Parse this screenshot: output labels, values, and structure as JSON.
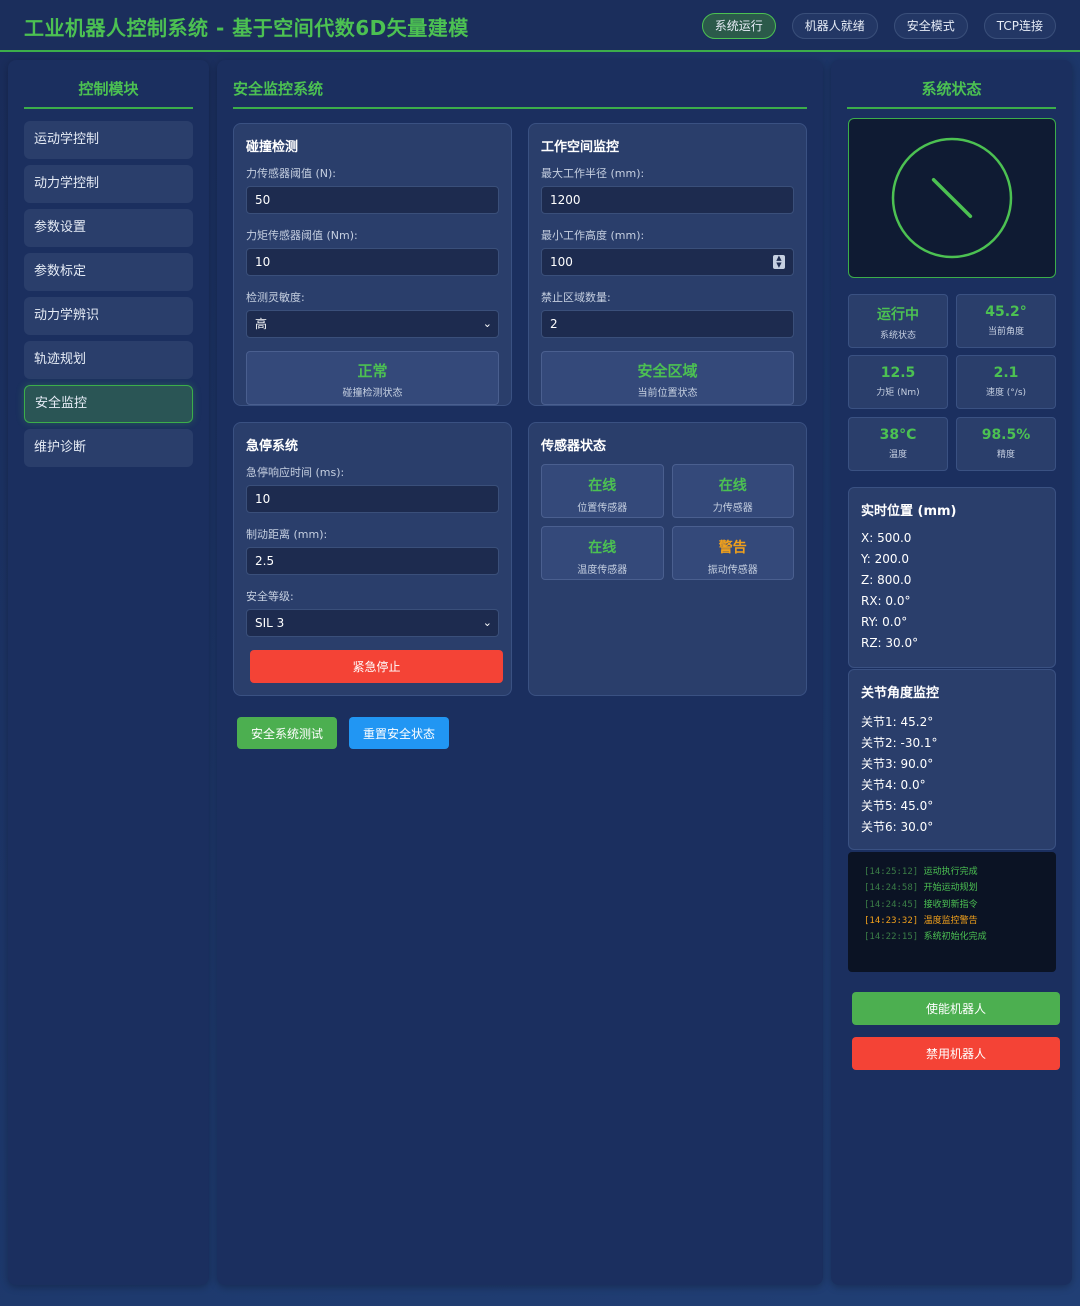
{
  "header": {
    "title": "工业机器人控制系统 - 基于空间代数6D矢量建模",
    "pills": [
      "系统运行",
      "机器人就绪",
      "安全模式",
      "TCP连接"
    ]
  },
  "sidebar": {
    "title": "控制模块",
    "items": [
      "运动学控制",
      "动力学控制",
      "参数设置",
      "参数标定",
      "动力学辨识",
      "轨迹规划",
      "安全监控",
      "维护诊断"
    ],
    "active_index": 6
  },
  "main": {
    "title": "安全监控系统",
    "collision": {
      "title": "碰撞检测",
      "force_label": "力传感器阈值 (N):",
      "force_value": "50",
      "torque_label": "力矩传感器阈值 (Nm):",
      "torque_value": "10",
      "sens_label": "检测灵敏度:",
      "sens_value": "高",
      "status_value": "正常",
      "status_label": "碰撞检测状态"
    },
    "workspace": {
      "title": "工作空间监控",
      "radius_label": "最大工作半径 (mm):",
      "radius_value": "1200",
      "height_label": "最小工作高度 (mm):",
      "height_value": "100",
      "zones_label": "禁止区域数量:",
      "zones_value": "2",
      "status_value": "安全区域",
      "status_label": "当前位置状态"
    },
    "estop": {
      "title": "急停系统",
      "resp_label": "急停响应时间 (ms):",
      "resp_value": "10",
      "brake_label": "制动距离 (mm):",
      "brake_value": "2.5",
      "level_label": "安全等级:",
      "level_value": "SIL 3",
      "button": "紧急停止"
    },
    "sensors": {
      "title": "传感器状态",
      "items": [
        {
          "status": "在线",
          "name": "位置传感器"
        },
        {
          "status": "在线",
          "name": "力传感器"
        },
        {
          "status": "在线",
          "name": "温度传感器"
        },
        {
          "status": "警告",
          "name": "振动传感器"
        }
      ]
    },
    "test_button": "安全系统测试",
    "reset_button": "重置安全状态"
  },
  "right": {
    "title": "系统状态",
    "viz_angle_deg": 45.2,
    "stats": [
      {
        "value": "运行中",
        "label": "系统状态"
      },
      {
        "value": "45.2°",
        "label": "当前角度"
      },
      {
        "value": "12.5",
        "label": "力矩 (Nm)"
      },
      {
        "value": "2.1",
        "label": "速度 (°/s)"
      },
      {
        "value": "38°C",
        "label": "温度"
      },
      {
        "value": "98.5%",
        "label": "精度"
      }
    ],
    "position": {
      "title": "实时位置 (mm)",
      "lines": [
        "X: 500.0",
        "Y: 200.0",
        "Z: 800.0",
        "RX: 0.0°",
        "RY: 0.0°",
        "RZ: 30.0°"
      ]
    },
    "joints": {
      "title": "关节角度监控",
      "lines": [
        "关节1: 45.2°",
        "关节2: -30.1°",
        "关节3: 90.0°",
        "关节4: 0.0°",
        "关节5: 45.0°",
        "关节6: 30.0°"
      ]
    },
    "log": [
      {
        "time": "[14:25:12]",
        "msg": "运动执行完成",
        "level": "info"
      },
      {
        "time": "[14:24:58]",
        "msg": "开始运动规划",
        "level": "info"
      },
      {
        "time": "[14:24:45]",
        "msg": "接收到新指令",
        "level": "info"
      },
      {
        "time": "[14:23:32]",
        "msg": "温度监控警告",
        "level": "warn"
      },
      {
        "time": "[14:22:15]",
        "msg": "系统初始化完成",
        "level": "info"
      }
    ],
    "enable_button": "使能机器人",
    "disable_button": "禁用机器人"
  },
  "colors": {
    "accent": "#4cc152",
    "warning": "#f0a01c",
    "danger": "#f44336",
    "info": "#2196f3",
    "panel": "#1b2f5f"
  }
}
